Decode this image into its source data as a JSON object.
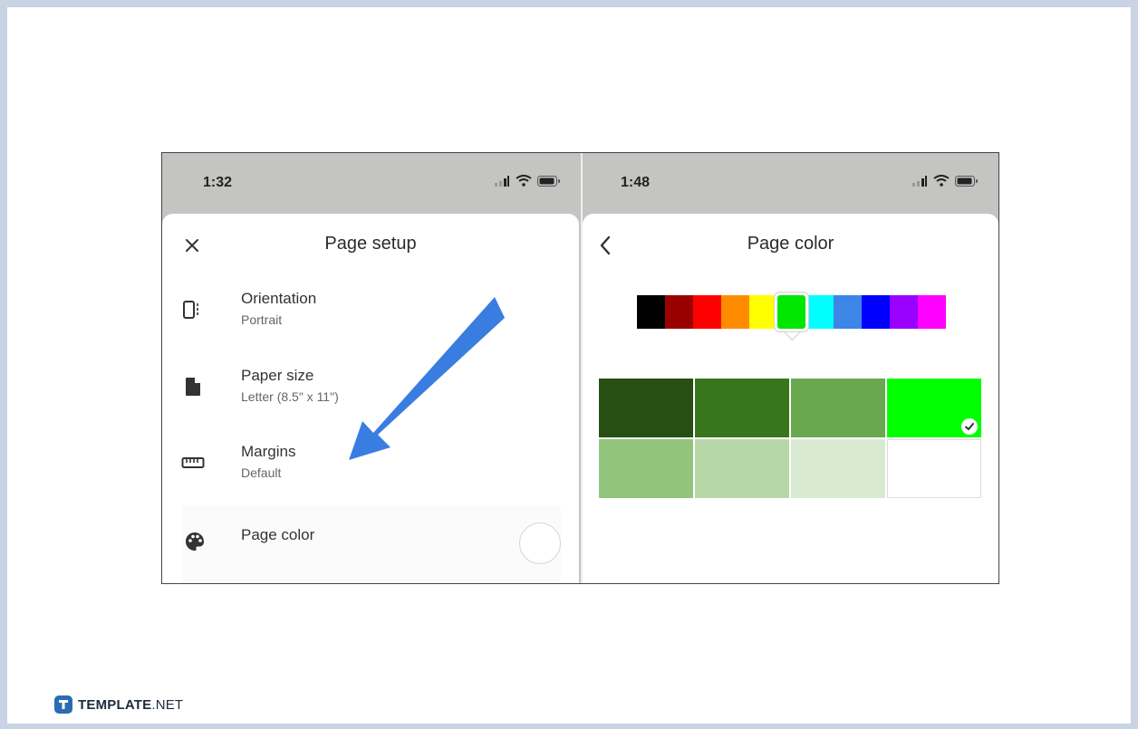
{
  "left_screen": {
    "status": {
      "time": "1:32"
    },
    "header": {
      "title": "Page setup",
      "close_icon": "close-icon"
    },
    "rows": [
      {
        "label": "Orientation",
        "value": "Portrait",
        "icon": "orientation-icon"
      },
      {
        "label": "Paper size",
        "value": "Letter (8.5\" x 11\")",
        "icon": "document-icon"
      },
      {
        "label": "Margins",
        "value": "Default",
        "icon": "ruler-icon"
      }
    ],
    "page_color_row": {
      "label": "Page color",
      "icon": "palette-icon",
      "current_color": "#ffffff"
    }
  },
  "right_screen": {
    "status": {
      "time": "1:48"
    },
    "header": {
      "title": "Page color",
      "back_icon": "chevron-left-icon"
    },
    "hue_swatches": [
      "#000000",
      "#9b0000",
      "#ff0000",
      "#ff8c00",
      "#ffff00",
      "#00e600",
      "#00ffff",
      "#3d85e6",
      "#0000ff",
      "#9900ff",
      "#ff00ff"
    ],
    "selected_hue": 5,
    "shades": [
      "#274e13",
      "#38761d",
      "#6aa84f",
      "#00ff00",
      "#93c47d",
      "#b6d7a8",
      "#d9ead3",
      "#ffffff"
    ],
    "selected_shade": 3
  },
  "annotation": {
    "arrow_color": "#3a7de0"
  },
  "brand": {
    "name": "TEMPLATE",
    "suffix": ".NET",
    "color": "#2b6cb0"
  }
}
